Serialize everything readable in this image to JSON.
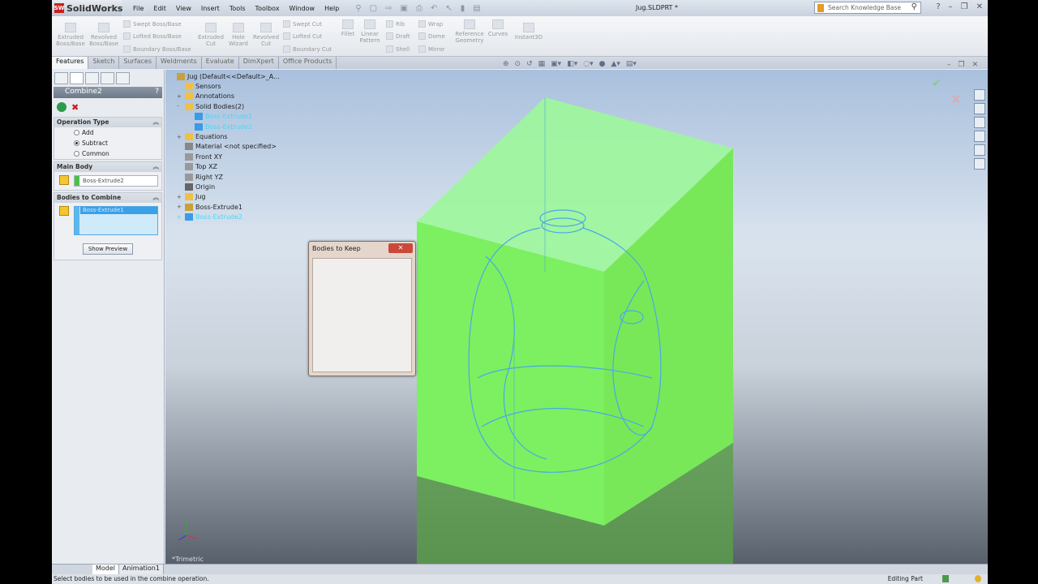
{
  "app": {
    "name": "SolidWorks",
    "doc_title": "Jug.SLDPRT *"
  },
  "menu": [
    "File",
    "Edit",
    "View",
    "Insert",
    "Tools",
    "Toolbox",
    "Window",
    "Help"
  ],
  "search": {
    "placeholder": "Search Knowledge Base"
  },
  "ribbon": {
    "extruded_boss": "Extruded Boss/Base",
    "revolved_boss": "Revolved Boss/Base",
    "swept_boss": "Swept Boss/Base",
    "lofted_boss": "Lofted Boss/Base",
    "boundary_boss": "Boundary Boss/Base",
    "extruded_cut": "Extruded Cut",
    "hole_wizard": "Hole Wizard",
    "revolved_cut": "Revolved Cut",
    "swept_cut": "Swept Cut",
    "lofted_cut": "Lofted Cut",
    "boundary_cut": "Boundary Cut",
    "fillet": "Fillet",
    "linear_pattern": "Linear Pattern",
    "rib": "Rib",
    "draft": "Draft",
    "shell": "Shell",
    "wrap": "Wrap",
    "dome": "Dome",
    "mirror": "Mirror",
    "reference_geometry": "Reference Geometry",
    "curves": "Curves",
    "instant3d": "Instant3D"
  },
  "tabs": [
    "Features",
    "Sketch",
    "Surfaces",
    "Weldments",
    "Evaluate",
    "DimXpert",
    "Office Products"
  ],
  "property_manager": {
    "title": "Combine2",
    "help": "?",
    "operation_type": {
      "label": "Operation Type",
      "options": [
        "Add",
        "Subtract",
        "Common"
      ],
      "selected": "Subtract"
    },
    "main_body": {
      "label": "Main Body",
      "value": "Boss-Extrude2"
    },
    "bodies_to_combine": {
      "label": "Bodies to Combine",
      "items": [
        "Boss-Extrude1"
      ]
    },
    "show_preview": "Show Preview"
  },
  "tree": [
    {
      "label": "Jug  (Default<<Default>_A...",
      "expand": ""
    },
    {
      "label": "Sensors",
      "expand": ""
    },
    {
      "label": "Annotations",
      "expand": "+"
    },
    {
      "label": "Solid Bodies(2)",
      "expand": "-"
    },
    {
      "label": "Boss-Extrude1",
      "expand": "",
      "highlight": true
    },
    {
      "label": "Boss-Extrude2",
      "expand": "",
      "highlight": true
    },
    {
      "label": "Equations",
      "expand": "+"
    },
    {
      "label": "Material <not specified>",
      "expand": ""
    },
    {
      "label": "Front XY",
      "expand": ""
    },
    {
      "label": "Top XZ",
      "expand": ""
    },
    {
      "label": "Right YZ",
      "expand": ""
    },
    {
      "label": "Origin",
      "expand": ""
    },
    {
      "label": "Jug",
      "expand": "+"
    },
    {
      "label": "Boss-Extrude1",
      "expand": "+"
    },
    {
      "label": "Boss-Extrude2",
      "expand": "+",
      "highlight": true
    }
  ],
  "dialog": {
    "title": "Bodies to Keep",
    "close": "✕"
  },
  "viewport": {
    "view_name": "*Trimetric",
    "box_color": "#7cf060",
    "sketch_color": "#4aa8e8"
  },
  "bottom_tabs": [
    "Model",
    "Animation1"
  ],
  "status": {
    "message": "Select bodies to be used in the combine operation.",
    "mode": "Editing Part"
  }
}
